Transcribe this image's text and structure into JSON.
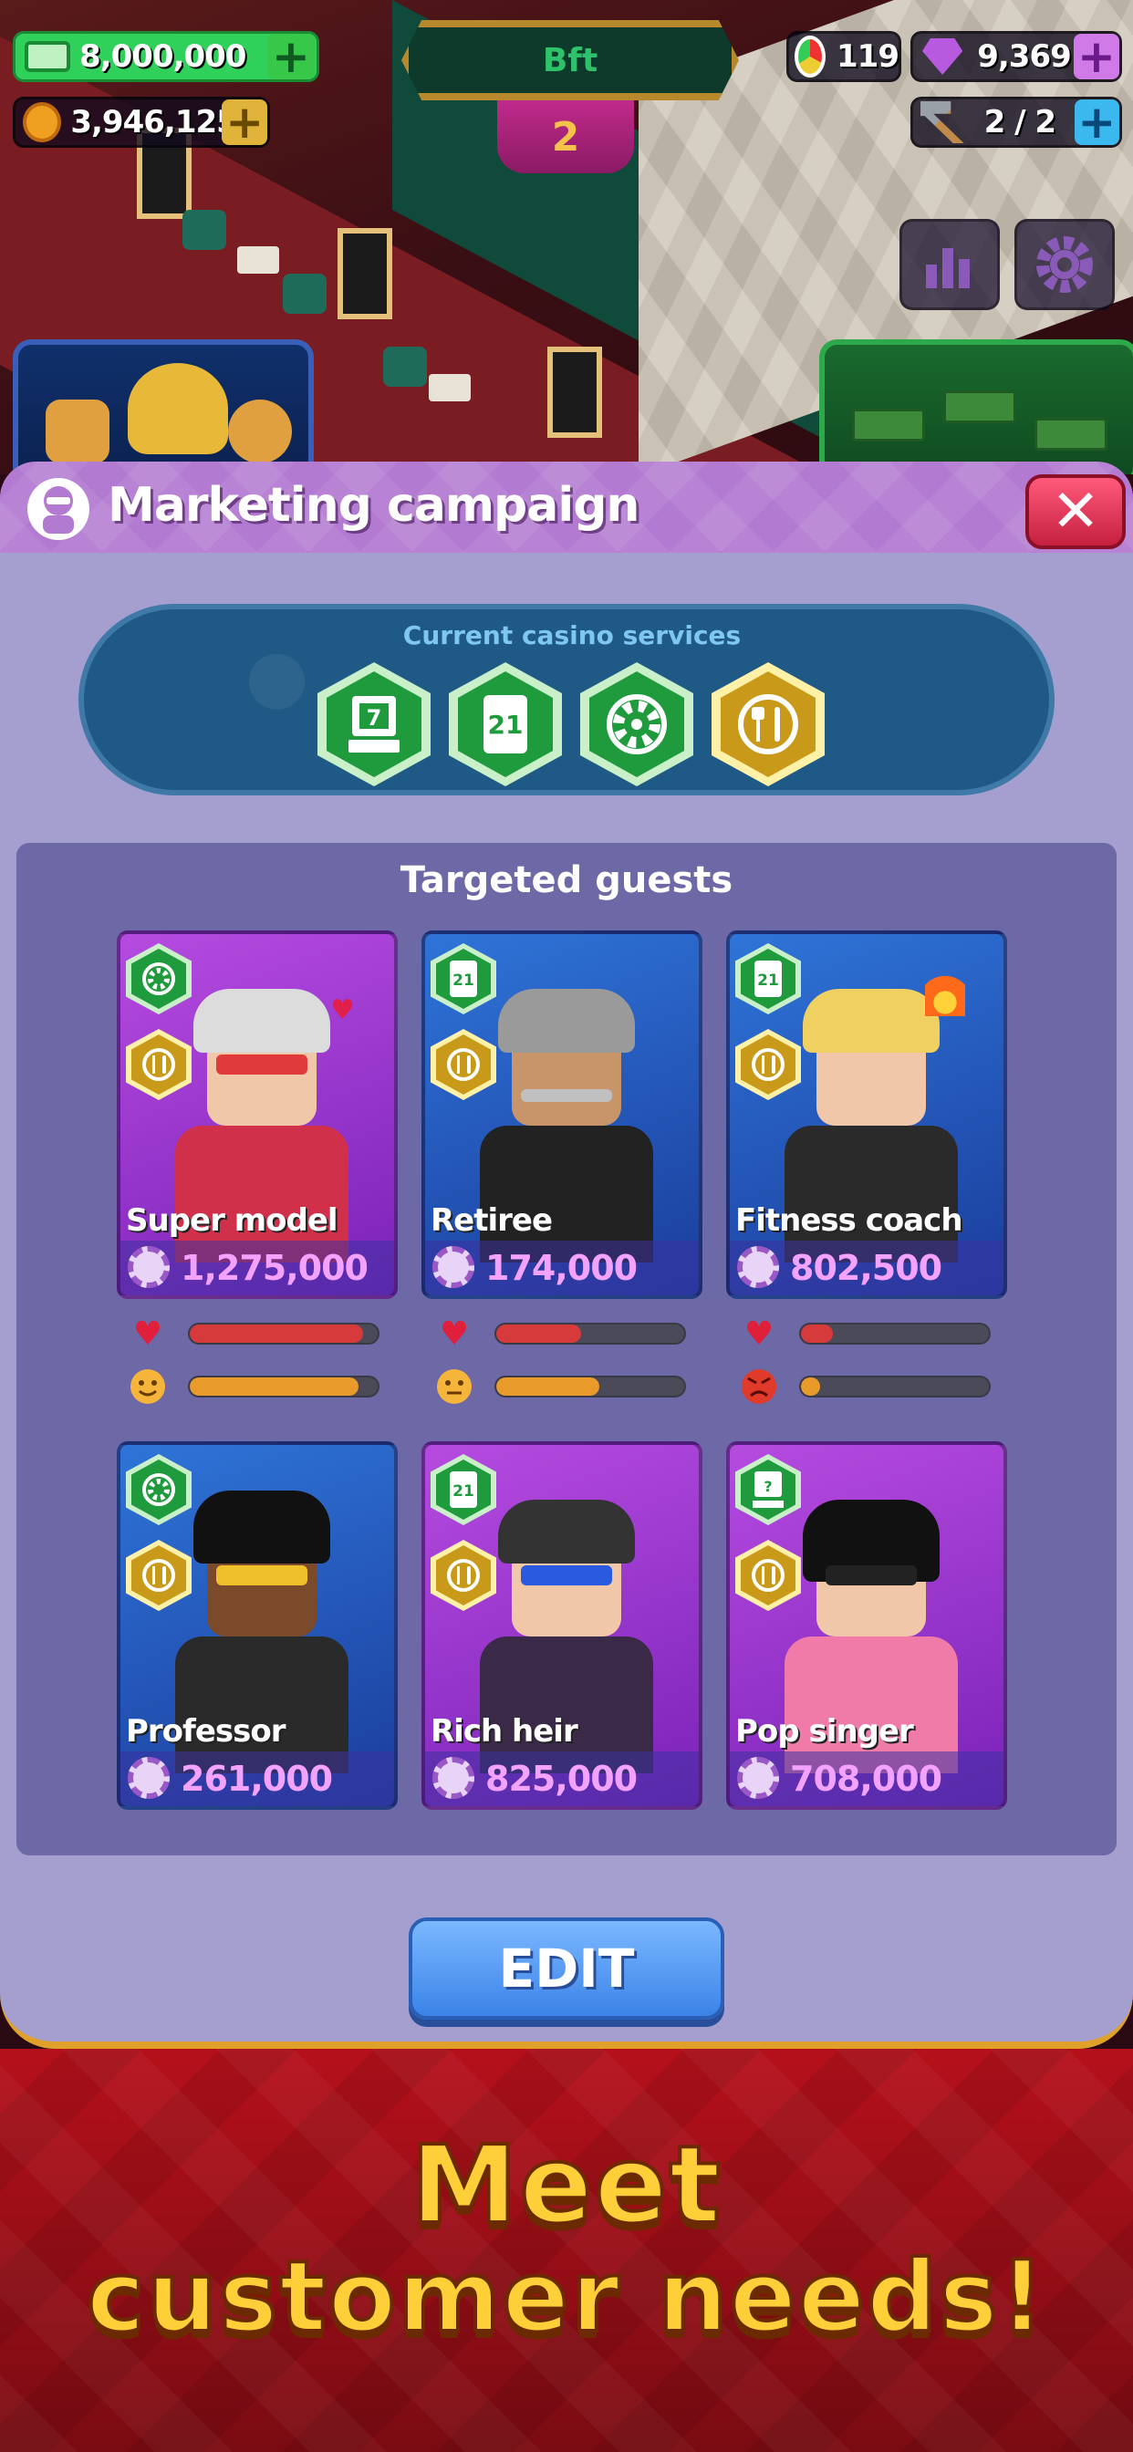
{
  "hud": {
    "cash": "8,000,000",
    "chips": "3,946,125",
    "floor_name": "Bft",
    "floor_number": "2",
    "reputation": "119",
    "gems": "9,369",
    "hammers": "2 / 2",
    "colors": {
      "cash_plus": "#37c84a",
      "chips_plus": "#e0b33a",
      "gems_plus": "#d07ae8",
      "hammer_plus": "#3bb8ee"
    }
  },
  "modal": {
    "title": "Marketing campaign",
    "services_label": "Current casino services",
    "services": [
      {
        "icon": "slot-machine-icon",
        "color": "#1f9a3c"
      },
      {
        "icon": "blackjack-21-icon",
        "color": "#1f9a3c"
      },
      {
        "icon": "roulette-icon",
        "color": "#1f9a3c"
      },
      {
        "icon": "restaurant-icon",
        "color": "#c99a1a"
      }
    ],
    "guests_title": "Targeted guests",
    "guests": [
      {
        "name": "Super model",
        "amount": "1,275,000",
        "satisfaction": 0.92,
        "mood": 0.9,
        "mood_icon": "smile-icon",
        "status_icon": "heart-icon"
      },
      {
        "name": "Retiree",
        "amount": "174,000",
        "satisfaction": 0.45,
        "mood": 0.55,
        "mood_icon": "neutral-face-icon",
        "status_icon": ""
      },
      {
        "name": "Fitness coach",
        "amount": "802,500",
        "satisfaction": 0.17,
        "mood": 0.1,
        "mood_icon": "angry-face-icon",
        "status_icon": "fire-icon"
      },
      {
        "name": "Professor",
        "amount": "261,000",
        "mood_icon": ""
      },
      {
        "name": "Rich heir",
        "amount": "825,000",
        "mood_icon": ""
      },
      {
        "name": "Pop singer",
        "amount": "708,000",
        "mood_icon": ""
      }
    ],
    "edit_label": "EDIT"
  },
  "promo": {
    "line1": "Meet",
    "line2": "customer needs!"
  }
}
